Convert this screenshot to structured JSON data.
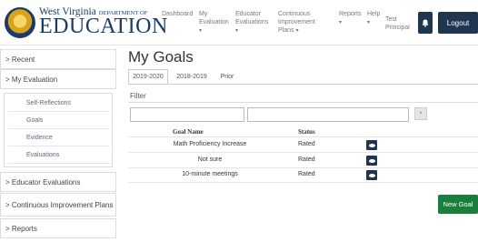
{
  "logo": {
    "top_text": "West Virginia",
    "top_small": "DEPARTMENT OF",
    "bottom_text": "EDUCATION"
  },
  "topnav": {
    "items": [
      {
        "label": "Dashboard"
      },
      {
        "label": "My Evaluation"
      },
      {
        "label": "Educator Evaluations"
      },
      {
        "label": "Continuous Improvement Plans"
      },
      {
        "label": "Reports"
      },
      {
        "label": "Help"
      }
    ],
    "user": "Test Principal",
    "logout_label": "Logout"
  },
  "sidebar": {
    "recent": "> Recent",
    "my_evaluation": "> My Evaluation",
    "sub_items": [
      {
        "label": "Self-Reflections"
      },
      {
        "label": "Goals"
      },
      {
        "label": "Evidence"
      },
      {
        "label": "Evaluations"
      }
    ],
    "educator_evaluations": "> Educator Evaluations",
    "continuous_improvement_plans": "> Continuous Improvement Plans",
    "reports": "> Reports"
  },
  "main": {
    "title": "My Goals",
    "tabs": [
      {
        "label": "2019-2020",
        "active": true
      },
      {
        "label": "2018-2019",
        "active": false
      },
      {
        "label": "Prior",
        "active": false
      }
    ],
    "filter_label": "Filter",
    "table": {
      "headers": {
        "goal_name": "Goal Name",
        "status": "Status"
      },
      "rows": [
        {
          "goal_name": "Math Proficiency Increase",
          "status": "Rated"
        },
        {
          "goal_name": "Not sure",
          "status": "Rated"
        },
        {
          "goal_name": "10-minute meetings",
          "status": "Rated"
        }
      ]
    },
    "new_goal_label": "New Goal"
  },
  "colors": {
    "brand_navy": "#1f3550",
    "new_goal_green": "#1a7e3c",
    "logo_blue": "#1b3a6b"
  }
}
